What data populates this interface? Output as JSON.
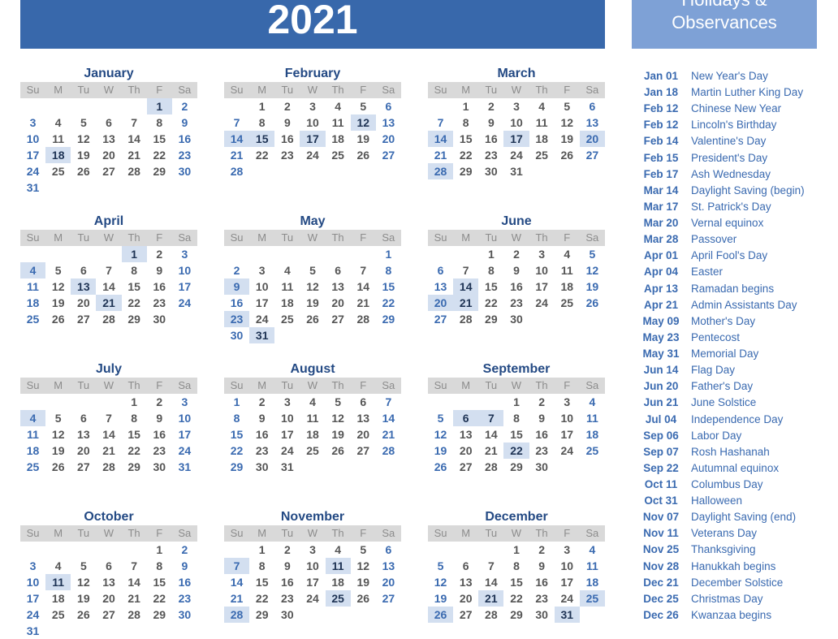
{
  "header": {
    "year": "2021"
  },
  "holidays_panel": {
    "title_line1": "Holidays &",
    "title_line2": "Observances"
  },
  "day_headers": [
    "Su",
    "M",
    "Tu",
    "W",
    "Th",
    "F",
    "Sa"
  ],
  "colors": {
    "banner": "#3868ab",
    "panel": "#7ea1d6",
    "weekend": "#3a6ab0",
    "weekday": "#555555",
    "highlight": "#d3dff0",
    "month_title": "#244a84"
  },
  "months": [
    {
      "name": "January",
      "first_weekday": 5,
      "days": 31,
      "highlights": [
        1,
        18
      ]
    },
    {
      "name": "February",
      "first_weekday": 1,
      "days": 28,
      "highlights": [
        12,
        14,
        15,
        17
      ]
    },
    {
      "name": "March",
      "first_weekday": 1,
      "days": 31,
      "highlights": [
        14,
        17,
        20,
        28
      ]
    },
    {
      "name": "April",
      "first_weekday": 4,
      "days": 30,
      "highlights": [
        1,
        4,
        13,
        21
      ]
    },
    {
      "name": "May",
      "first_weekday": 6,
      "days": 31,
      "highlights": [
        9,
        23,
        31
      ]
    },
    {
      "name": "June",
      "first_weekday": 2,
      "days": 30,
      "highlights": [
        14,
        20,
        21
      ]
    },
    {
      "name": "July",
      "first_weekday": 4,
      "days": 31,
      "highlights": [
        4
      ]
    },
    {
      "name": "August",
      "first_weekday": 0,
      "days": 31,
      "highlights": []
    },
    {
      "name": "September",
      "first_weekday": 3,
      "days": 30,
      "highlights": [
        6,
        7,
        22
      ]
    },
    {
      "name": "October",
      "first_weekday": 5,
      "days": 31,
      "highlights": [
        11
      ]
    },
    {
      "name": "November",
      "first_weekday": 1,
      "days": 30,
      "highlights": [
        7,
        11,
        25,
        28
      ]
    },
    {
      "name": "December",
      "first_weekday": 3,
      "days": 31,
      "highlights": [
        21,
        25,
        26,
        31
      ]
    }
  ],
  "holidays": [
    {
      "date": "Jan 01",
      "name": "New Year's Day"
    },
    {
      "date": "Jan 18",
      "name": "Martin Luther King Day"
    },
    {
      "date": "Feb 12",
      "name": "Chinese New Year"
    },
    {
      "date": "Feb 12",
      "name": "Lincoln's Birthday"
    },
    {
      "date": "Feb 14",
      "name": "Valentine's Day"
    },
    {
      "date": "Feb 15",
      "name": "President's Day"
    },
    {
      "date": "Feb 17",
      "name": "Ash Wednesday"
    },
    {
      "date": "Mar 14",
      "name": "Daylight Saving (begin)"
    },
    {
      "date": "Mar 17",
      "name": "St. Patrick's Day"
    },
    {
      "date": "Mar 20",
      "name": "Vernal equinox"
    },
    {
      "date": "Mar 28",
      "name": "Passover"
    },
    {
      "date": "Apr 01",
      "name": "April Fool's Day"
    },
    {
      "date": "Apr 04",
      "name": "Easter"
    },
    {
      "date": "Apr 13",
      "name": "Ramadan begins"
    },
    {
      "date": "Apr 21",
      "name": "Admin Assistants Day"
    },
    {
      "date": "May 09",
      "name": "Mother's Day"
    },
    {
      "date": "May 23",
      "name": "Pentecost"
    },
    {
      "date": "May 31",
      "name": "Memorial Day"
    },
    {
      "date": "Jun 14",
      "name": "Flag Day"
    },
    {
      "date": "Jun 20",
      "name": "Father's Day"
    },
    {
      "date": "Jun 21",
      "name": "June Solstice"
    },
    {
      "date": "Jul 04",
      "name": "Independence Day"
    },
    {
      "date": "Sep 06",
      "name": "Labor Day"
    },
    {
      "date": "Sep 07",
      "name": "Rosh Hashanah"
    },
    {
      "date": "Sep 22",
      "name": "Autumnal equinox"
    },
    {
      "date": "Oct 11",
      "name": "Columbus Day"
    },
    {
      "date": "Oct 31",
      "name": "Halloween"
    },
    {
      "date": "Nov 07",
      "name": "Daylight Saving (end)"
    },
    {
      "date": "Nov 11",
      "name": "Veterans Day"
    },
    {
      "date": "Nov 25",
      "name": "Thanksgiving"
    },
    {
      "date": "Nov 28",
      "name": "Hanukkah begins"
    },
    {
      "date": "Dec 21",
      "name": "December Solstice"
    },
    {
      "date": "Dec 25",
      "name": "Christmas Day"
    },
    {
      "date": "Dec 26",
      "name": "Kwanzaa begins"
    }
  ]
}
